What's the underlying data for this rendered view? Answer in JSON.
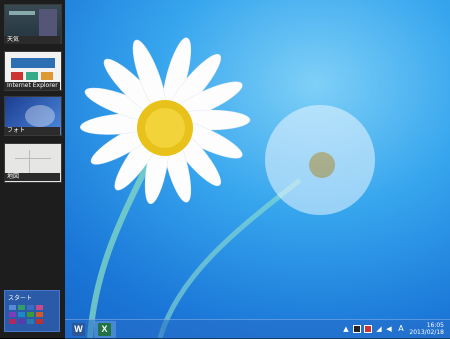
{
  "switcher": {
    "apps": [
      {
        "label": "天気"
      },
      {
        "label": "Internet Explorer"
      },
      {
        "label": "フォト"
      },
      {
        "label": "地図"
      }
    ],
    "start_label": "スタート"
  },
  "taskbar": {
    "apps": [
      {
        "name": "word",
        "glyph": "W"
      },
      {
        "name": "excel",
        "glyph": "X"
      }
    ],
    "tray": {
      "ime_indicator": "A",
      "time": "16:05",
      "date": "2013/02/18"
    }
  },
  "colors": {
    "word": "#2b579a",
    "excel": "#217346",
    "start_tile": "#2a5aa8"
  }
}
